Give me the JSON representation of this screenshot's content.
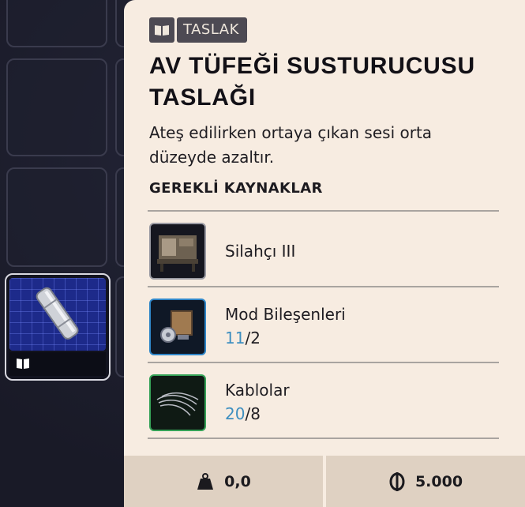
{
  "tooltip": {
    "badge_label": "TASLAK",
    "title": "AV TÜFEĞİ SUSTURUCUSU TASLAĞI",
    "description": "Ateş edilirken ortaya çıkan sesi orta düzeyde azaltır.",
    "section_label": "GEREKLİ KAYNAKLAR",
    "requirements": [
      {
        "name": "Silahçı III"
      },
      {
        "name": "Mod Bileşenleri",
        "have": "11",
        "need": "/2"
      },
      {
        "name": "Kablolar",
        "have": "20",
        "need": "/8"
      }
    ],
    "weight": "0,0",
    "price": "5.000"
  },
  "colors": {
    "panel": "#f7ece1",
    "have_count": "#3e8fc0",
    "rarity_blue": "#2f86c8",
    "rarity_green": "#35a257"
  },
  "icons": [
    "blueprint-book-icon",
    "weight-icon",
    "coin-icon"
  ]
}
